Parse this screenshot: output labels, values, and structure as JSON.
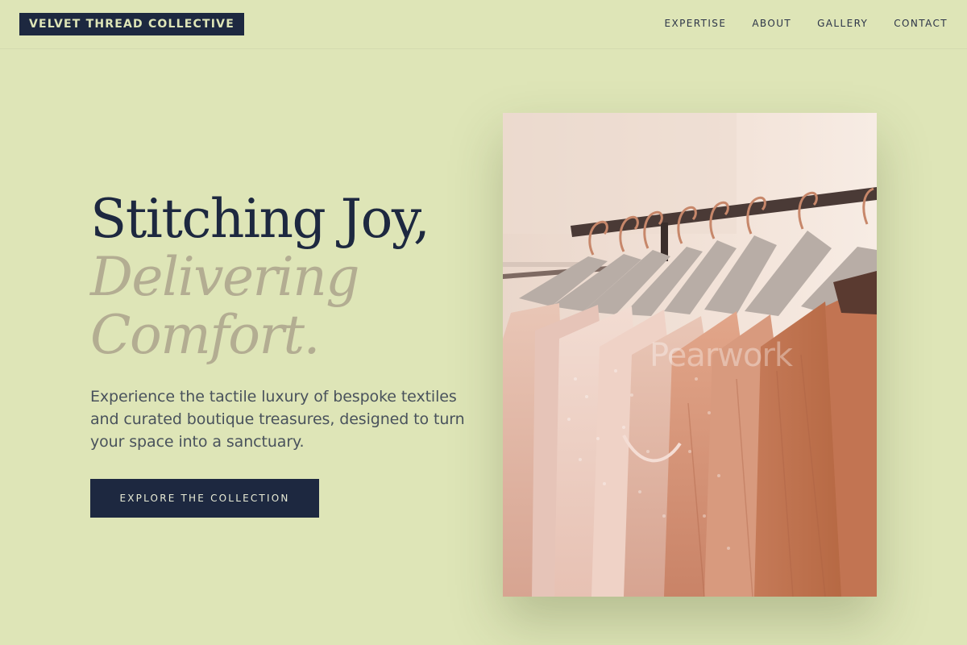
{
  "header": {
    "brand": "VELVET THREAD COLLECTIVE",
    "nav": [
      "EXPERTISE",
      "ABOUT",
      "GALLERY",
      "CONTACT"
    ]
  },
  "hero": {
    "headline_line1": "Stitching Joy,",
    "headline_line2": "Delivering",
    "headline_line3": "Comfort.",
    "description": "Experience the tactile luxury of bespoke textiles and curated boutique treasures, designed to turn your space into a sanctuary.",
    "cta_label": "EXPLORE THE COLLECTION"
  },
  "image": {
    "watermark": "Pearwork",
    "subject": "garments-on-rack"
  },
  "colors": {
    "background": "#dee5b7",
    "navy": "#1d2840",
    "accent_italic": "#b3ad92"
  }
}
